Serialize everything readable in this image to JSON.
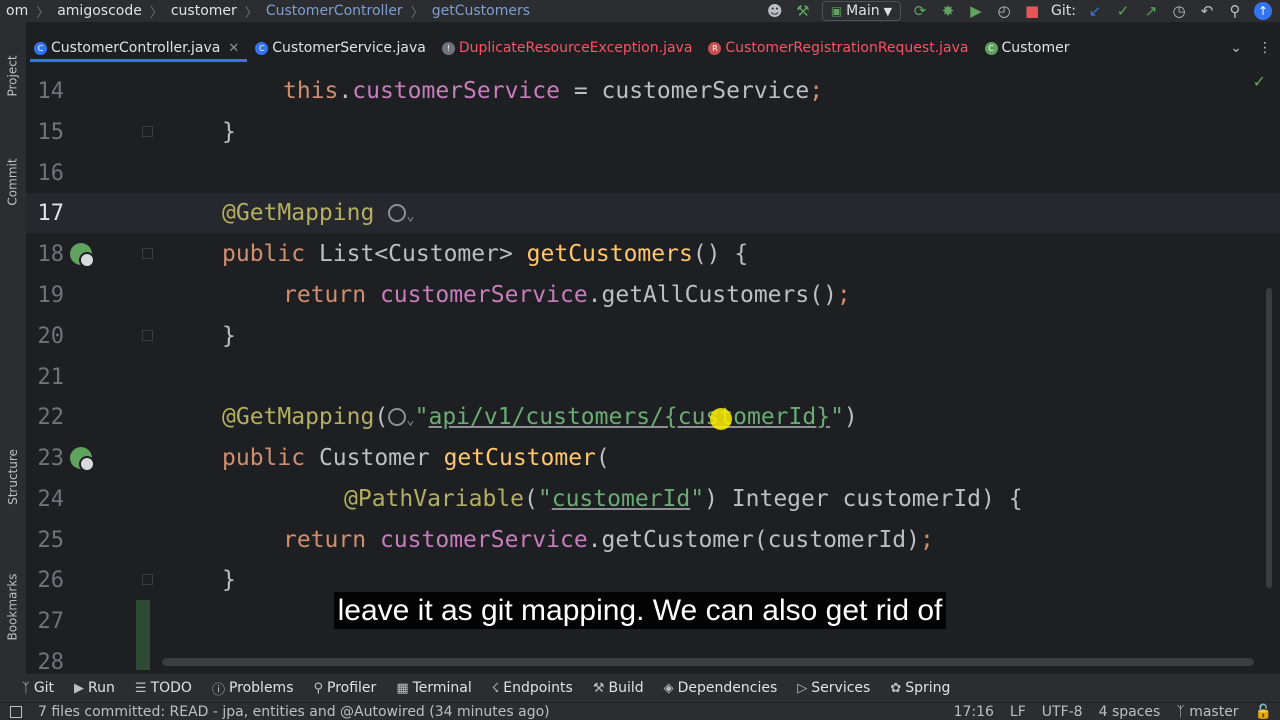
{
  "navbar": {
    "crumbs": [
      "om",
      "amigoscode",
      "customer",
      "CustomerController",
      "getCustomers"
    ],
    "branch": "Main",
    "git_label": "Git:"
  },
  "tabs": [
    {
      "label": "CustomerController.java",
      "active": true,
      "error": false,
      "icon_color": "#3574f0"
    },
    {
      "label": "CustomerService.java",
      "active": false,
      "error": false,
      "icon_color": "#3574f0"
    },
    {
      "label": "DuplicateResourceException.java",
      "active": false,
      "error": true,
      "icon_color": "#6f737a"
    },
    {
      "label": "CustomerRegistrationRequest.java",
      "active": false,
      "error": true,
      "icon_color": "#c94f4f"
    },
    {
      "label": "Customer",
      "active": false,
      "error": false,
      "icon_color": "#5fa35f"
    }
  ],
  "sidebar_left": {
    "project": "Project",
    "commit": "Commit",
    "structure": "Structure",
    "bookmarks": "Bookmarks"
  },
  "editor": {
    "lines": [
      "14",
      "15",
      "16",
      "17",
      "18",
      "19",
      "20",
      "21",
      "22",
      "23",
      "24",
      "25",
      "26",
      "27",
      "28"
    ],
    "current_line": "17",
    "code": {
      "l14_this": "this",
      "l14_dot": ".",
      "l14_field": "customerService",
      "l14_rest": " = customerService",
      "l14_semi": ";",
      "l15": "}",
      "l17_ann": "@GetMapping",
      "l18_kw": "public",
      "l18_type": " List<Customer> ",
      "l18_fn": "getCustomers",
      "l18_rest": "() {",
      "l19_kw": "return",
      "l19_field": "customerService",
      "l19_rest": ".getAllCustomers()",
      "l19_semi": ";",
      "l20": "}",
      "l22_ann": "@GetMapping",
      "l22_paren": "(",
      "l22_q1": "\"",
      "l22_path": "api/v1/customers/{customerId}",
      "l22_q2": "\"",
      "l22_end": ")",
      "l23_kw": "public",
      "l23_type": " Customer ",
      "l23_fn": "getCustomer",
      "l23_rest": "(",
      "l24_ann": "@PathVariable",
      "l24_paren": "(",
      "l24_q1": "\"",
      "l24_str": "customerId",
      "l24_q2": "\"",
      "l24_rest": ") Integer customerId) {",
      "l25_kw": "return",
      "l25_field": "customerService",
      "l25_rest": ".getCustomer(customerId)",
      "l25_semi": ";",
      "l26": "}"
    }
  },
  "subtitle": "leave it as git mapping. We can also get rid of",
  "tool_windows": [
    "Git",
    "Run",
    "TODO",
    "Problems",
    "Profiler",
    "Terminal",
    "Endpoints",
    "Build",
    "Dependencies",
    "Services",
    "Spring"
  ],
  "status": {
    "message": "7 files committed: READ - jpa, entities and @Autowired (34 minutes ago)",
    "position": "17:16",
    "line_sep": "LF",
    "encoding": "UTF-8",
    "indent": "4 spaces",
    "branch": "master"
  }
}
